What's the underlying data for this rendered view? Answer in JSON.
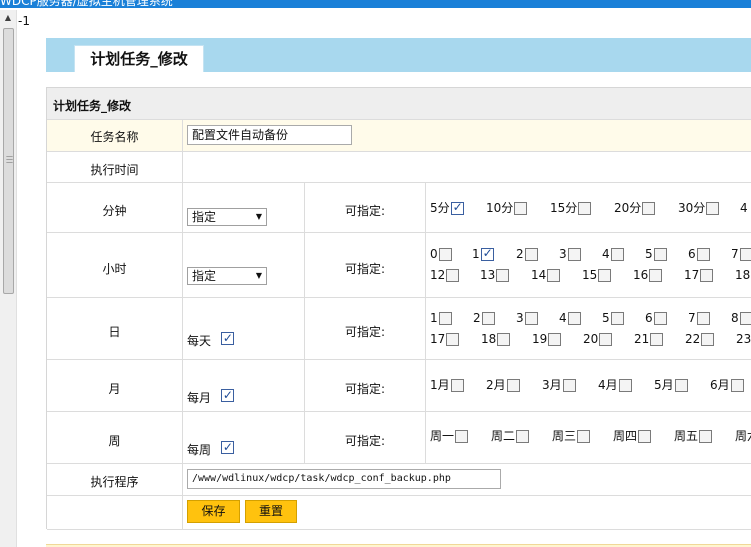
{
  "window": {
    "title": "WDCP服务器/虚拟主机管理系统"
  },
  "corner_text": "-1",
  "header": {
    "tab_label": "计划任务_修改"
  },
  "form": {
    "title": "计划任务_修改",
    "task_name": {
      "label": "任务名称",
      "value": "配置文件自动备份"
    },
    "exec_time_label": "执行时间",
    "minute": {
      "label": "分钟",
      "select_value": "指定",
      "specify_label": "可指定:",
      "options": [
        {
          "label": "5分",
          "checked": true
        },
        {
          "label": "10分",
          "checked": false
        },
        {
          "label": "15分",
          "checked": false
        },
        {
          "label": "20分",
          "checked": false
        },
        {
          "label": "30分",
          "checked": false
        },
        {
          "label": "4",
          "checked": false
        }
      ]
    },
    "hour": {
      "label": "小时",
      "select_value": "指定",
      "specify_label": "可指定:",
      "row1": [
        {
          "label": "0",
          "checked": false
        },
        {
          "label": "1",
          "checked": true
        },
        {
          "label": "2",
          "checked": false
        },
        {
          "label": "3",
          "checked": false
        },
        {
          "label": "4",
          "checked": false
        },
        {
          "label": "5",
          "checked": false
        },
        {
          "label": "6",
          "checked": false
        },
        {
          "label": "7",
          "checked": false
        }
      ],
      "row2": [
        {
          "label": "12",
          "checked": false
        },
        {
          "label": "13",
          "checked": false
        },
        {
          "label": "14",
          "checked": false
        },
        {
          "label": "15",
          "checked": false
        },
        {
          "label": "16",
          "checked": false
        },
        {
          "label": "17",
          "checked": false
        },
        {
          "label": "18",
          "checked": false
        }
      ]
    },
    "day": {
      "label": "日",
      "every_label": "每天",
      "every_checked": true,
      "specify_label": "可指定:",
      "row1": [
        {
          "label": "1",
          "checked": false
        },
        {
          "label": "2",
          "checked": false
        },
        {
          "label": "3",
          "checked": false
        },
        {
          "label": "4",
          "checked": false
        },
        {
          "label": "5",
          "checked": false
        },
        {
          "label": "6",
          "checked": false
        },
        {
          "label": "7",
          "checked": false
        },
        {
          "label": "8",
          "checked": false
        }
      ],
      "row2": [
        {
          "label": "17",
          "checked": false
        },
        {
          "label": "18",
          "checked": false
        },
        {
          "label": "19",
          "checked": false
        },
        {
          "label": "20",
          "checked": false
        },
        {
          "label": "21",
          "checked": false
        },
        {
          "label": "22",
          "checked": false
        },
        {
          "label": "23",
          "checked": false
        }
      ]
    },
    "month": {
      "label": "月",
      "every_label": "每月",
      "every_checked": true,
      "specify_label": "可指定:",
      "options": [
        {
          "label": "1月",
          "checked": false
        },
        {
          "label": "2月",
          "checked": false
        },
        {
          "label": "3月",
          "checked": false
        },
        {
          "label": "4月",
          "checked": false
        },
        {
          "label": "5月",
          "checked": false
        },
        {
          "label": "6月",
          "checked": false
        }
      ]
    },
    "week": {
      "label": "周",
      "every_label": "每周",
      "every_checked": true,
      "specify_label": "可指定:",
      "options": [
        {
          "label": "周一",
          "checked": false
        },
        {
          "label": "周二",
          "checked": false
        },
        {
          "label": "周三",
          "checked": false
        },
        {
          "label": "周四",
          "checked": false
        },
        {
          "label": "周五",
          "checked": false
        },
        {
          "label": "周六",
          "checked": false
        }
      ]
    },
    "program": {
      "label": "执行程序",
      "value": "/www/wdlinux/wdcp/task/wdcp_conf_backup.php"
    },
    "buttons": {
      "save": "保存",
      "reset": "重置"
    }
  }
}
